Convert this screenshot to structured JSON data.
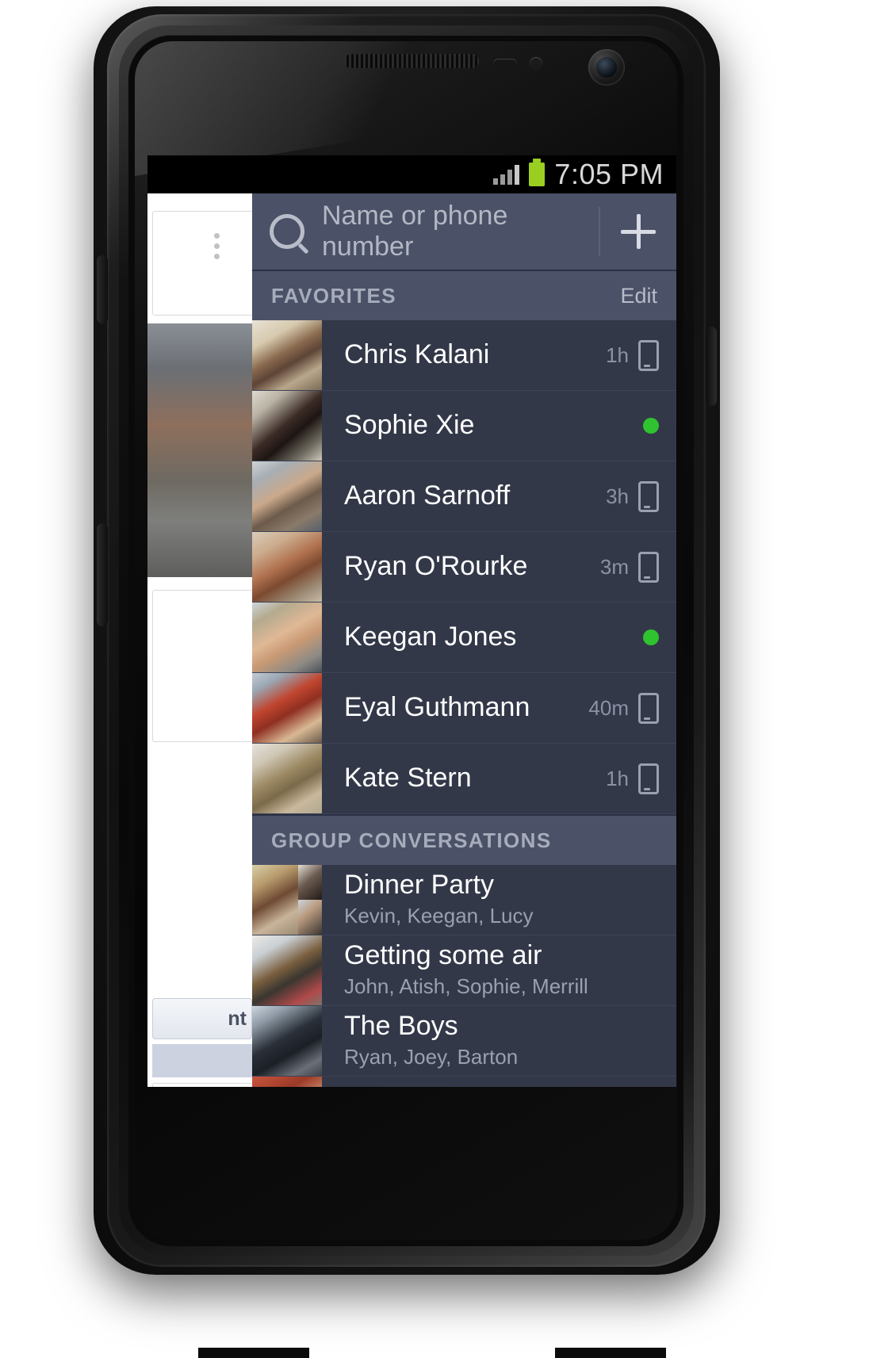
{
  "status_bar": {
    "time": "7:05 PM",
    "signal_icon": "signal-bars-icon",
    "battery_icon": "battery-full-icon"
  },
  "header": {
    "contacts_icon": "contacts-list-icon",
    "search": {
      "placeholder": "Name or phone number",
      "value": "",
      "icon": "search-icon"
    },
    "add_icon": "plus-icon",
    "accent_blue": "#4b6ead",
    "bar_color": "#4b5167"
  },
  "sections": [
    {
      "title": "FAVORITES",
      "action": "Edit"
    },
    {
      "title": "GROUP CONVERSATIONS",
      "action": ""
    }
  ],
  "favorites": [
    {
      "name": "Chris Kalani",
      "time": "1h",
      "status": "mobile",
      "avatar": "avatar-chris"
    },
    {
      "name": "Sophie Xie",
      "time": "",
      "status": "online",
      "avatar": "avatar-sophie"
    },
    {
      "name": "Aaron Sarnoff",
      "time": "3h",
      "status": "mobile",
      "avatar": "avatar-aaron"
    },
    {
      "name": "Ryan O'Rourke",
      "time": "3m",
      "status": "mobile",
      "avatar": "avatar-ryan"
    },
    {
      "name": "Keegan Jones",
      "time": "",
      "status": "online",
      "avatar": "avatar-keegan"
    },
    {
      "name": "Eyal Guthmann",
      "time": "40m",
      "status": "mobile",
      "avatar": "avatar-eyal"
    },
    {
      "name": "Kate Stern",
      "time": "1h",
      "status": "mobile",
      "avatar": "avatar-kate"
    }
  ],
  "groups": [
    {
      "name": "Dinner Party",
      "members": "Kevin, Keegan, Lucy",
      "avatar": "avatar-group-dinner"
    },
    {
      "name": "Getting some air",
      "members": "John, Atish, Sophie, Merrill",
      "avatar": "avatar-group-air"
    },
    {
      "name": "The Boys",
      "members": "Ryan, Joey, Barton",
      "avatar": "avatar-group-boys"
    }
  ],
  "colors": {
    "online_green": "#2fc32f",
    "row_bg": "#333849",
    "section_bg": "#4b5167",
    "panel_bg": "#343a4d"
  },
  "background_app": {
    "visible_button_text": "nt",
    "menu_icon": "kebab-menu-icon"
  }
}
